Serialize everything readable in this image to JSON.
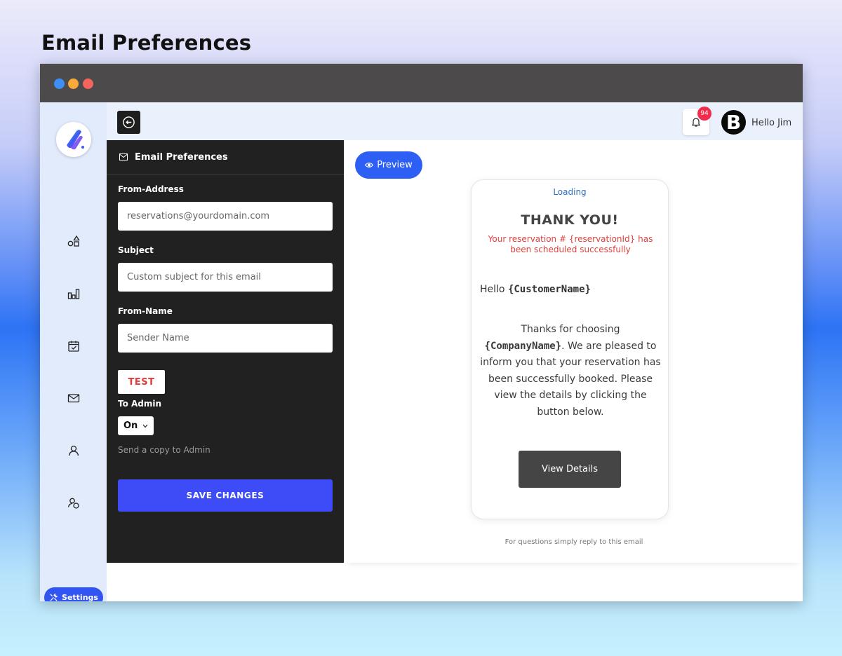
{
  "page": {
    "title": "Email Preferences"
  },
  "sidebar": {
    "icons": [
      "shapes-icon",
      "bar-chart-icon",
      "calendar-check-icon",
      "mail-icon",
      "user-icon",
      "users-icon"
    ],
    "settings_label": "Settings"
  },
  "topbar": {
    "notification_count": "94",
    "avatar_letter": "B",
    "greeting": "Hello Jim"
  },
  "panel": {
    "title": "Email Preferences",
    "from_address": {
      "label": "From-Address",
      "placeholder": "reservations@yourdomain.com"
    },
    "subject": {
      "label": "Subject",
      "placeholder": "Custom subject for this email"
    },
    "from_name": {
      "label": "From-Name",
      "placeholder": "Sender Name"
    },
    "test_label": "TEST",
    "to_admin": {
      "label": "To Admin",
      "value": "On",
      "hint": "Send a copy to Admin"
    },
    "save_label": "SAVE CHANGES"
  },
  "preview": {
    "button_label": "Preview",
    "loading": "Loading",
    "heading": "THANK YOU!",
    "reservation_text": "Your reservation # {reservationId} has been scheduled successfully",
    "hello": "Hello",
    "customer_var": "{CustomerName}",
    "msg_before": "Thanks for choosing",
    "company_var": "{CompanyName}",
    "msg_after": ". We are pleased to inform you that your reservation has been successfully booked. Please view the details by clicking the button below.",
    "view_details_label": "View Details",
    "footer_note": "For questions simply reply to this email"
  },
  "colors": {
    "accent_blue": "#3d4cf6",
    "panel_dark": "#212121",
    "error_red": "#e0403e",
    "badge_red": "#f12c4d"
  }
}
